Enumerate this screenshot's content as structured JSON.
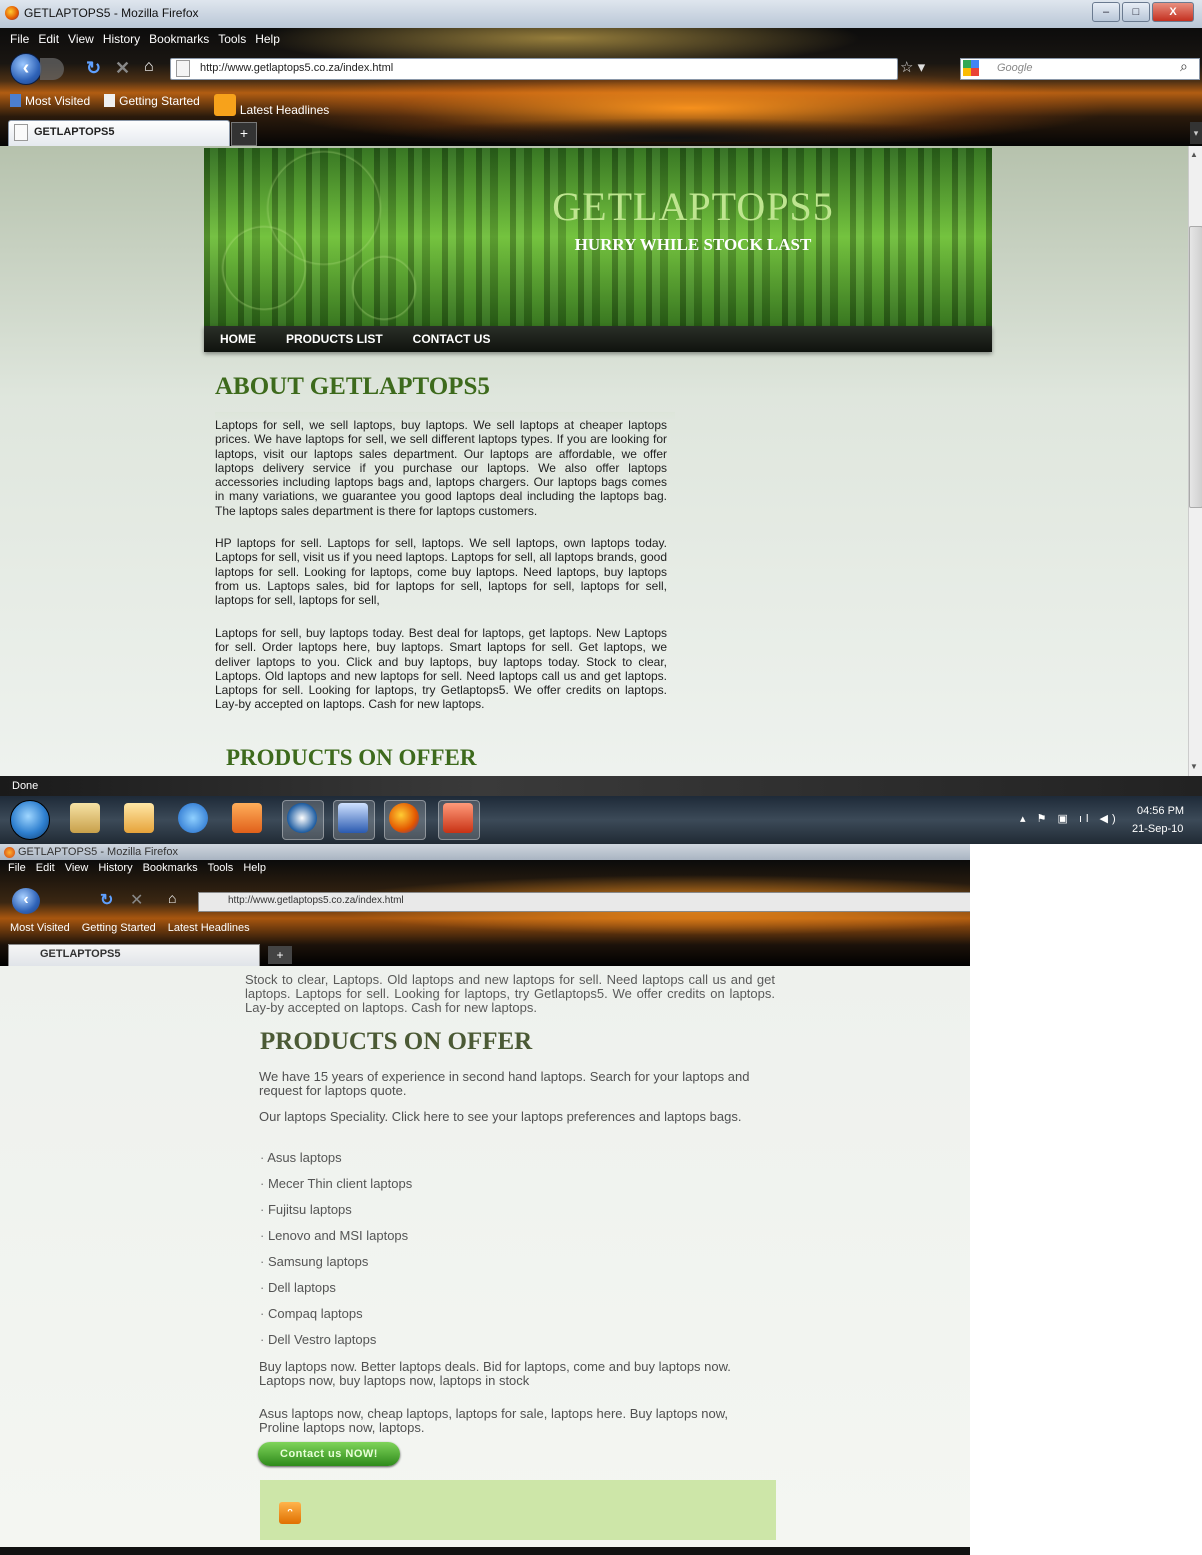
{
  "window": {
    "title": "GETLAPTOPS5 - Mozilla Firefox",
    "controls": [
      "–",
      "□",
      "X"
    ]
  },
  "menu": [
    "File",
    "Edit",
    "View",
    "History",
    "Bookmarks",
    "Tools",
    "Help"
  ],
  "toolbar": {
    "url": "http://www.getlaptops5.co.za/index.html",
    "search_placeholder": "Google"
  },
  "bookmarks": [
    "Most Visited",
    "Getting Started",
    "Latest Headlines"
  ],
  "tab": {
    "label": "GETLAPTOPS5",
    "new_tab": "+"
  },
  "site": {
    "title": "GETLAPTOPS5",
    "tagline": "HURRY WHILE STOCK LAST",
    "nav": [
      "HOME",
      "PRODUCTS LIST",
      "CONTACT US"
    ]
  },
  "about": {
    "heading": "ABOUT GETLAPTOPS5",
    "paragraphs": [
      "Laptops for sell, we sell laptops, buy laptops. We sell laptops at cheaper laptops prices. We have laptops for sell, we sell different laptops types. If you are looking for laptops, visit our laptops sales department. Our laptops are affordable, we offer laptops delivery service if you purchase our laptops. We also offer laptops accessories including laptops bags and, laptops chargers. Our laptops bags comes in many variations, we guarantee you good laptops deal including the laptops bag. The laptops sales department is there for laptops customers.",
      "HP laptops for sell. Laptops for sell, laptops. We sell laptops, own laptops today. Laptops for sell, visit us if you need laptops. Laptops for sell, all laptops brands, good laptops for sell. Looking for laptops, come buy laptops. Need laptops, buy laptops from us. Laptops sales, bid for laptops for sell, laptops for sell, laptops for sell, laptops for sell, laptops for sell,",
      "Laptops for sell, buy laptops today. Best deal for laptops, get laptops. New Laptops for sell. Order laptops here, buy laptops. Smart laptops for sell. Get laptops, we deliver laptops to you. Click and buy laptops, buy laptops today. Stock to clear, Laptops. Old laptops and new laptops for sell. Need laptops call us and get laptops. Laptops for sell. Looking for laptops, try Getlaptops5. We offer credits on laptops. Lay-by accepted on laptops. Cash for new laptops."
    ]
  },
  "products": {
    "heading": "PRODUCTS ON OFFER",
    "intro": "We have 15 years of experience in second hand laptops. Search for your laptops and request for laptops quote.",
    "speciality": "Our laptops Speciality. Click here to see your laptops preferences and laptops bags.",
    "items": [
      "Asus laptops",
      "Mecer Thin client laptops",
      "Fujitsu laptops",
      "Lenovo and MSI laptops",
      "Samsung laptops",
      "Dell laptops",
      "Compaq laptops",
      "Dell Vestro laptops"
    ],
    "buy_text": "Buy laptops now. Better laptops deals. Bid for laptops, come and buy laptops now. Laptops now, buy laptops now, laptops in stock",
    "asus_text": "Asus laptops now, cheap laptops, laptops for sale, laptops here. Buy laptops now, Proline laptops now, laptops.",
    "cta": "Contact us NOW!"
  },
  "second_view_top_text": "Stock to clear, Laptops. Old laptops and new laptops for sell. Need laptops call us and get laptops. Laptops for sell. Looking for laptops, try Getlaptops5. We offer credits on laptops. Lay-by accepted on laptops. Cash for new laptops.",
  "status": "Done",
  "taskbar": {
    "time": "04:56 PM",
    "date": "21-Sep-10"
  }
}
